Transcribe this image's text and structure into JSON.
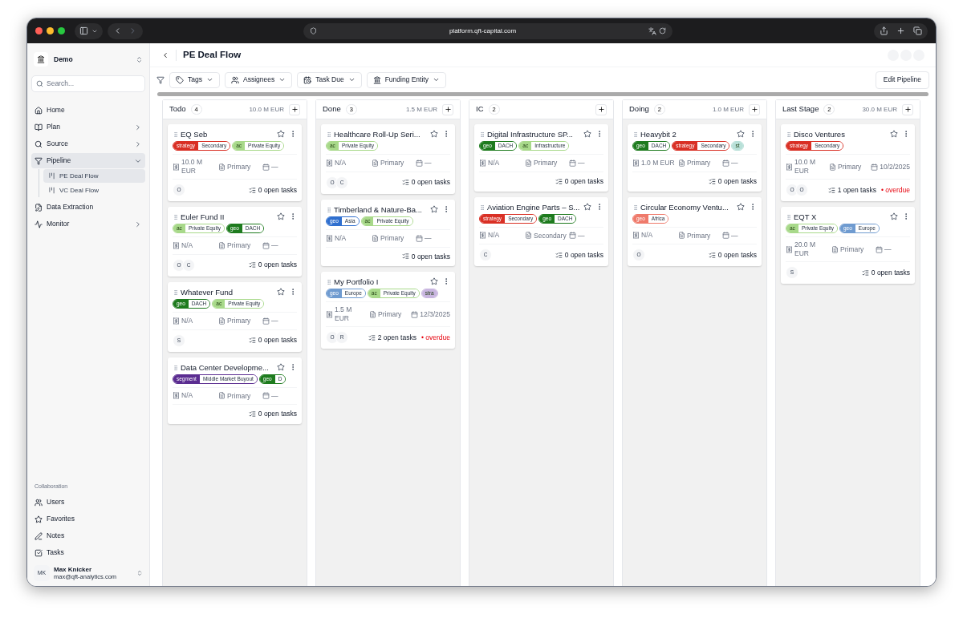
{
  "browser": {
    "url": "platform.qft-capital.com"
  },
  "sidebar": {
    "workspace": "Demo",
    "search": {
      "placeholder": "Search..."
    },
    "items": [
      {
        "kind": "home",
        "label": "Home",
        "selected": false
      },
      {
        "kind": "plan",
        "label": "Plan",
        "selected": false,
        "expanded": false
      },
      {
        "kind": "source",
        "label": "Source",
        "selected": false,
        "expanded": false
      },
      {
        "kind": "pipeline",
        "label": "Pipeline",
        "selected": true,
        "expanded": true,
        "children": [
          {
            "label": "PE Deal Flow",
            "selected": true
          },
          {
            "label": "VC Deal Flow",
            "selected": false
          }
        ]
      },
      {
        "kind": "extraction",
        "label": "Data Extraction",
        "selected": false
      },
      {
        "kind": "monitor",
        "label": "Monitor",
        "selected": false,
        "expanded": false
      }
    ],
    "section_title": "Collaboration",
    "collab_items": [
      {
        "kind": "users",
        "label": "Users"
      },
      {
        "kind": "favorites",
        "label": "Favorites"
      },
      {
        "kind": "notes",
        "label": "Notes"
      },
      {
        "kind": "tasks",
        "label": "Tasks"
      }
    ],
    "user": {
      "initials": "MK",
      "name": "Max Knicker",
      "email": "max@qft-analytics.com"
    }
  },
  "header": {
    "title": "PE Deal Flow"
  },
  "filters": [
    {
      "kind": "tags",
      "label": "Tags"
    },
    {
      "kind": "assignees",
      "label": "Assignees"
    },
    {
      "kind": "due",
      "label": "Task Due"
    },
    {
      "kind": "entity",
      "label": "Funding Entity"
    }
  ],
  "edit_button": "Edit Pipeline",
  "columns": [
    {
      "name": "Todo",
      "count": "4",
      "total": "10.0 M EUR",
      "cards": [
        {
          "title": "EQ Seb",
          "tags": [
            {
              "label": "strategy",
              "value": "Secondary",
              "color": "#d93025"
            },
            {
              "label": "ac",
              "value": "Private Equity",
              "color": "#a8d98a"
            }
          ],
          "amount": "10.0 M EUR",
          "type": "Primary",
          "date": "—",
          "avatars": [
            "O"
          ],
          "tasks": "0 open tasks"
        },
        {
          "title": "Euler Fund II",
          "tags": [
            {
              "label": "ac",
              "value": "Private Equity",
              "color": "#a8d98a"
            },
            {
              "label": "geo",
              "value": "DACH",
              "color": "#1e7b1e"
            }
          ],
          "amount": "N/A",
          "type": "Primary",
          "date": "—",
          "avatars": [
            "O",
            "C"
          ],
          "tasks": "0 open tasks"
        },
        {
          "title": "Whatever Fund",
          "tags": [
            {
              "label": "geo",
              "value": "DACH",
              "color": "#1e7b1e"
            },
            {
              "label": "ac",
              "value": "Private Equity",
              "color": "#a8d98a"
            }
          ],
          "amount": "N/A",
          "type": "Primary",
          "date": "—",
          "avatars": [
            "S"
          ],
          "tasks": "0 open tasks"
        },
        {
          "title": "Data Center Developme...",
          "tags": [
            {
              "label": "segment",
              "value": "Middle Market Buyout",
              "color": "#5b2d91"
            },
            {
              "label": "geo",
              "value": "D",
              "color": "#1e7b1e"
            }
          ],
          "amount": "N/A",
          "type": "Primary",
          "date": "—",
          "tasks": "0 open tasks"
        }
      ]
    },
    {
      "name": "Done",
      "count": "3",
      "total": "1.5 M EUR",
      "cards": [
        {
          "title": "Healthcare Roll-Up Seri...",
          "tags": [
            {
              "label": "ac",
              "value": "Private Equity",
              "color": "#a8d98a"
            }
          ],
          "amount": "N/A",
          "type": "Primary",
          "date": "—",
          "avatars": [
            "O",
            "C"
          ],
          "tasks": "0 open tasks"
        },
        {
          "title": "Timberland & Nature-Ba...",
          "tags": [
            {
              "label": "geo",
              "value": "Asia",
              "color": "#2f6fcf"
            },
            {
              "label": "ac",
              "value": "Private Equity",
              "color": "#a8d98a"
            }
          ],
          "amount": "N/A",
          "type": "Primary",
          "date": "—",
          "tasks": "0 open tasks"
        },
        {
          "title": "My Portfolio I",
          "tags": [
            {
              "label": "geo",
              "value": "Europe",
              "color": "#6f9bd0"
            },
            {
              "label": "ac",
              "value": "Private Equity",
              "color": "#a8d98a"
            },
            {
              "label": "stra",
              "color": "#c9b6e0"
            }
          ],
          "amount": "1.5 M EUR",
          "type": "Primary",
          "date": "12/3/2025",
          "avatars": [
            "O",
            "R"
          ],
          "tasks": "2 open tasks",
          "overdue": "• overdue"
        }
      ]
    },
    {
      "name": "IC",
      "count": "2",
      "cards": [
        {
          "title": "Digital Infrastructure SP...",
          "tags": [
            {
              "label": "geo",
              "value": "DACH",
              "color": "#1e7b1e"
            },
            {
              "label": "ac",
              "value": "Infrastructure",
              "color": "#a8d98a"
            }
          ],
          "amount": "N/A",
          "type": "Primary",
          "date": "—",
          "tasks": "0 open tasks"
        },
        {
          "title": "Aviation Engine Parts – S...",
          "tags": [
            {
              "label": "strategy",
              "value": "Secondary",
              "color": "#d93025"
            },
            {
              "label": "geo",
              "value": "DACH",
              "color": "#1e7b1e"
            }
          ],
          "amount": "N/A",
          "type": "Secondary",
          "date": "—",
          "avatars": [
            "C"
          ],
          "tasks": "0 open tasks"
        }
      ]
    },
    {
      "name": "Doing",
      "count": "2",
      "total": "1.0 M EUR",
      "cards": [
        {
          "title": "Heavybit 2",
          "tags": [
            {
              "label": "geo",
              "value": "DACH",
              "color": "#1e7b1e"
            },
            {
              "label": "strategy",
              "value": "Secondary",
              "color": "#d93025"
            },
            {
              "label": "st",
              "color": "#b8e0d8"
            }
          ],
          "amount": "1.0 M EUR",
          "type": "Primary",
          "date": "—",
          "tasks": "0 open tasks"
        },
        {
          "title": "Circular Economy Ventu...",
          "tags": [
            {
              "label": "geo",
              "value": "Africa",
              "color": "#ef7a6b"
            }
          ],
          "amount": "N/A",
          "type": "Primary",
          "date": "—",
          "avatars": [
            "O"
          ],
          "tasks": "0 open tasks"
        }
      ]
    },
    {
      "name": "Last Stage",
      "count": "2",
      "total": "30.0 M EUR",
      "cards": [
        {
          "title": "Disco Ventures",
          "tags": [
            {
              "label": "strategy",
              "value": "Secondary",
              "color": "#d93025"
            }
          ],
          "amount": "10.0 M EUR",
          "type": "Primary",
          "date": "10/2/2025",
          "avatars": [
            "O",
            "O"
          ],
          "tasks": "1 open tasks",
          "overdue": "• overdue"
        },
        {
          "title": "EQT X",
          "tags": [
            {
              "label": "ac",
              "value": "Private Equity",
              "color": "#a8d98a"
            },
            {
              "label": "geo",
              "value": "Europe",
              "color": "#6f9bd0"
            }
          ],
          "amount": "20.0 M EUR",
          "type": "Primary",
          "date": "—",
          "avatars": [
            "S"
          ],
          "tasks": "0 open tasks"
        }
      ]
    }
  ]
}
